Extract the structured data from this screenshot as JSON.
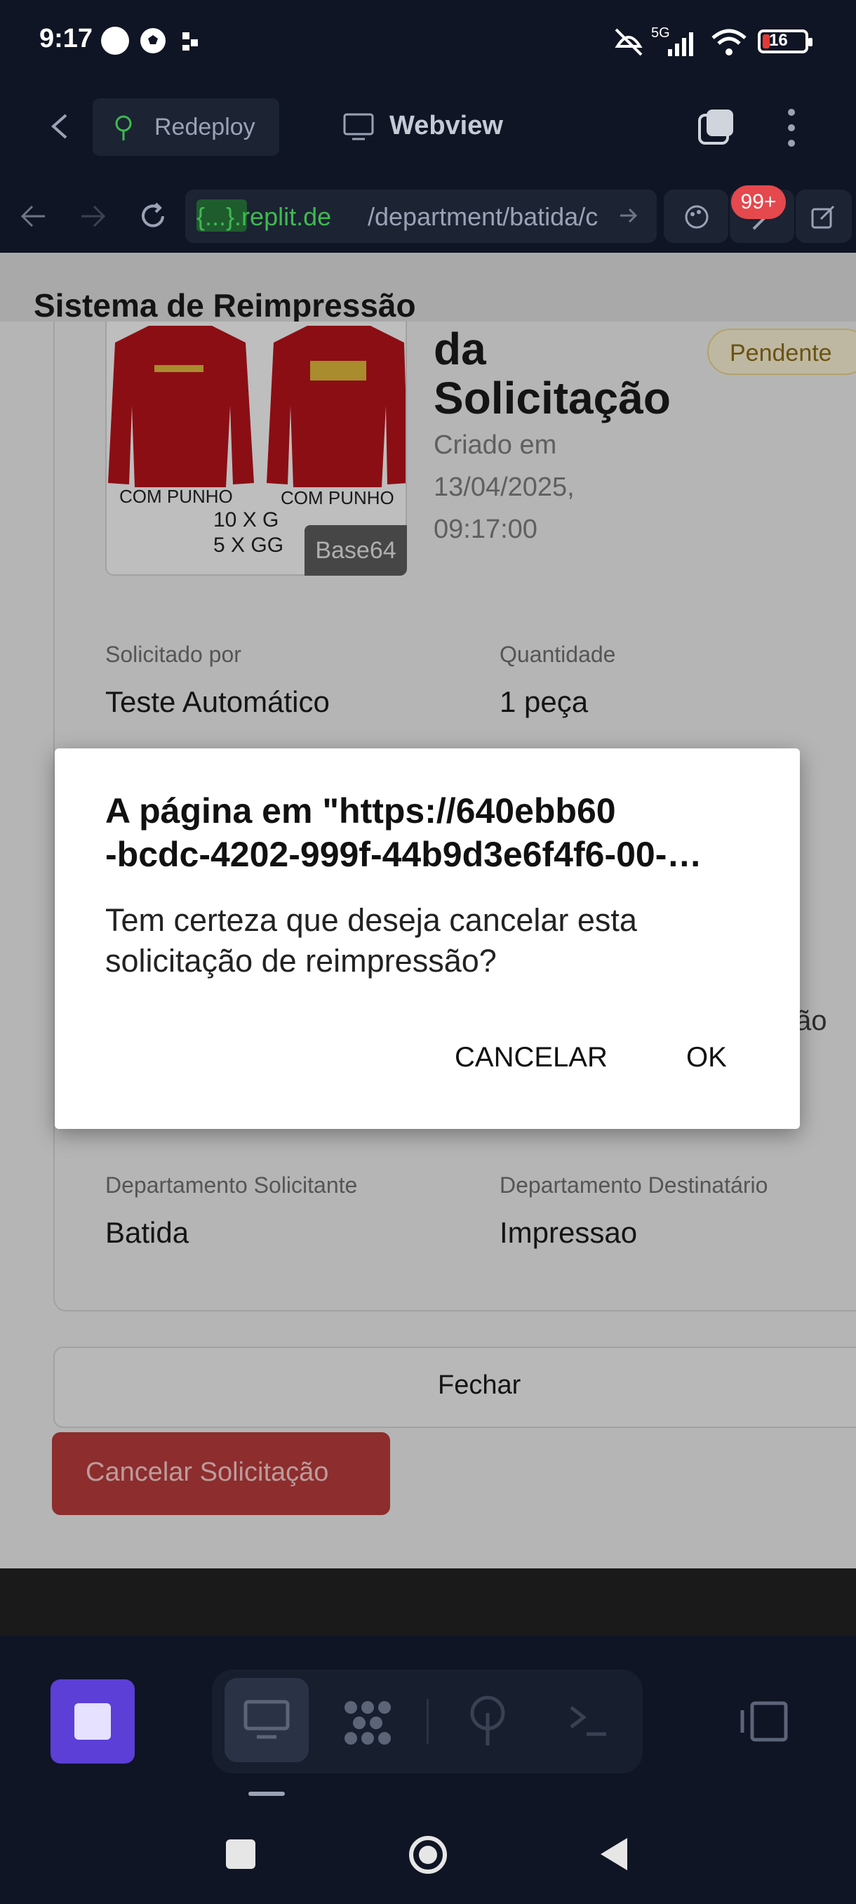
{
  "status_bar": {
    "time": "9:17",
    "network": "5G",
    "battery": "16"
  },
  "app_bar": {
    "redeploy_label": "Redeploy",
    "webview_label": "Webview"
  },
  "browser": {
    "url_host": "{...}.replit.de",
    "url_path": "/department/batida/c",
    "notification_badge": "99+"
  },
  "page": {
    "title": "Sistema de Reimpressão"
  },
  "detail": {
    "title_line1": "da",
    "title_line2": "Solicitação",
    "created_label": "Criado em",
    "created_date": "13/04/2025,",
    "created_time": "09:17:00",
    "status": "Pendente",
    "thumbnail": {
      "label_left": "COM PUNHO",
      "label_right": "COM PUNHO",
      "qty_line1": "10 X G",
      "qty_line2": "5 X GG",
      "badge": "Base64"
    },
    "requested_by_label": "Solicitado por",
    "requested_by_value": "Teste Automático",
    "quantity_label": "Quantidade",
    "quantity_value": "1 peça",
    "overflow_text": "ão",
    "dept_from_label": "Departamento Solicitante",
    "dept_from_value": "Batida",
    "dept_to_label": "Departamento Destinatário",
    "dept_to_value": "Impressao",
    "close_button": "Fechar",
    "cancel_request_button": "Cancelar Solicitação"
  },
  "dialog": {
    "title_line1": "A página em \"https://640ebb60",
    "title_line2": "-bcdc-4202-999f-44b9d3e6f4f6-00-…",
    "message": "Tem certeza que deseja cancelar esta solicitação de reimpressão?",
    "cancel_label": "CANCELAR",
    "ok_label": "OK"
  },
  "colors": {
    "accent_purple": "#5b3fd6",
    "danger_red": "#b53a3a",
    "pending_yellow": "#8a6a16",
    "replit_green": "#3fb950"
  },
  "icons": [
    "back-arrow-icon",
    "redeploy-icon",
    "monitor-icon",
    "tabs-icon",
    "more-vert-icon",
    "browser-back-icon",
    "browser-forward-icon",
    "reload-icon",
    "url-arrow-icon",
    "palette-icon",
    "tools-icon",
    "external-link-icon",
    "stop-icon",
    "webview-icon",
    "workflows-icon",
    "deploy-icon",
    "terminal-icon",
    "layout-icon",
    "android-recents-icon",
    "android-home-icon",
    "android-back-icon"
  ]
}
